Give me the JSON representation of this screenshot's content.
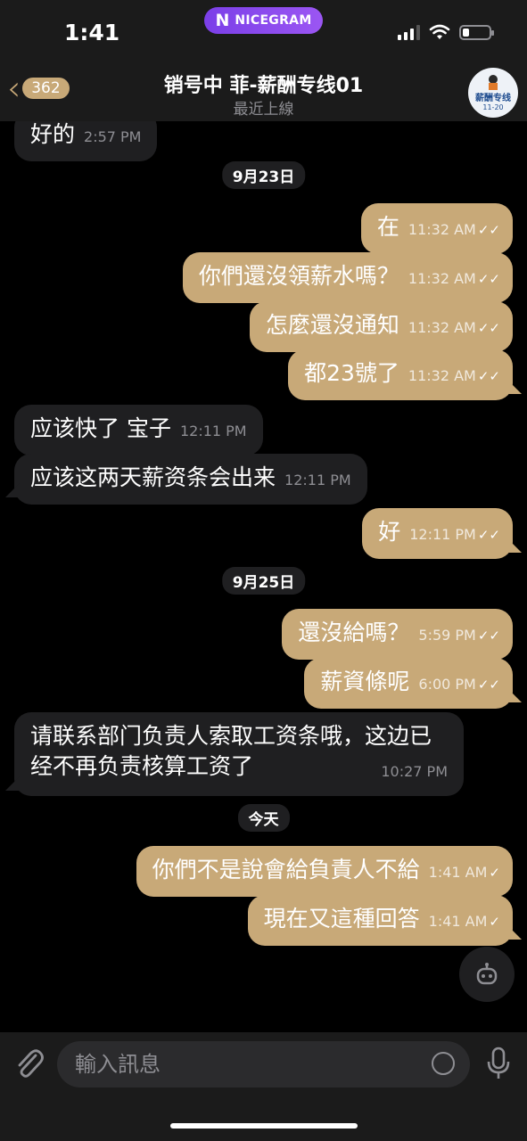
{
  "status_bar": {
    "time": "1:41",
    "nicegram": "NICEGRAM"
  },
  "header": {
    "back_count": "362",
    "title": "销号中 菲-薪酬专线01",
    "subtitle": "最近上線",
    "avatar_text": "薪酬专线",
    "avatar_sub": "11-20"
  },
  "messages": [
    {
      "side": "in",
      "text": "好的",
      "time": "2:57 PM"
    },
    {
      "date": "9月23日"
    },
    {
      "side": "out",
      "text": "在",
      "time": "11:32 AM",
      "status": "read"
    },
    {
      "side": "out",
      "text": "你們還沒領薪水嗎？",
      "time": "11:32 AM",
      "status": "read"
    },
    {
      "side": "out",
      "text": "怎麼還沒通知",
      "time": "11:32 AM",
      "status": "read"
    },
    {
      "side": "out",
      "text": "都23號了",
      "time": "11:32 AM",
      "status": "read"
    },
    {
      "side": "in",
      "text": "应该快了 宝子",
      "time": "12:11 PM"
    },
    {
      "side": "in",
      "text": "应该这两天薪资条会出来",
      "time": "12:11 PM"
    },
    {
      "side": "out",
      "text": "好",
      "time": "12:11 PM",
      "status": "read"
    },
    {
      "date": "9月25日"
    },
    {
      "side": "out",
      "text": "還沒給嗎？",
      "time": "5:59 PM",
      "status": "read"
    },
    {
      "side": "out",
      "text": "薪資條呢",
      "time": "6:00 PM",
      "status": "read"
    },
    {
      "side": "in",
      "text": "请联系部门负责人索取工资条哦，这边已经不再负责核算工资了",
      "time": "10:27 PM"
    },
    {
      "date": "今天"
    },
    {
      "side": "out",
      "text": "你們不是說會給負責人不給",
      "time": "1:41 AM",
      "status": "sent"
    },
    {
      "side": "out",
      "text": "現在又這種回答",
      "time": "1:41 AM",
      "status": "sent"
    }
  ],
  "input": {
    "placeholder": "輸入訊息"
  },
  "icons": {
    "back": "chevron-left-icon",
    "attach": "paperclip-icon",
    "sticker": "sticker-icon",
    "mic": "microphone-icon",
    "bot": "bot-icon"
  },
  "colors": {
    "outgoing_bubble": "#c8a978",
    "incoming_bubble": "#1f1f21",
    "background": "#000000",
    "accent": "#c8a978"
  }
}
